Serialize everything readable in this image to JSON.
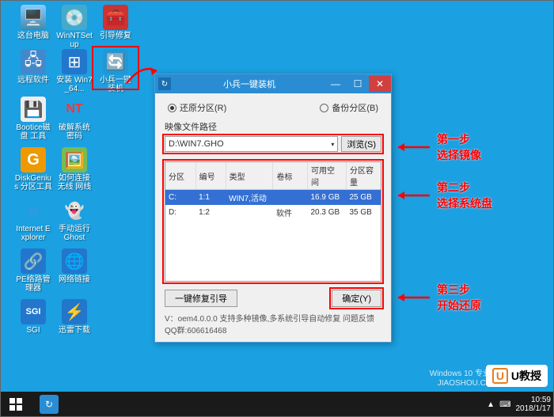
{
  "desktop_icons": {
    "r0c0": "这台电脑",
    "r0c1": "WinNTSetup",
    "r0c2": "引导修复",
    "r1c0": "远程软件",
    "r1c1": "安装\nWin7_64...",
    "r1c2": "小兵一键装机",
    "r2c0": "Bootice磁盘\n工具",
    "r2c1": "破解系统密码",
    "r3c0": "DiskGenius\n分区工具",
    "r3c1": "如何连接无线\n网线",
    "r4c0": "Internet\nExplorer",
    "r4c1": "手动运行\nGhost",
    "r5c0": "PE络路管理器",
    "r5c1": "网络链接",
    "r6c0": "SGI",
    "r6c1": "迅雷下载"
  },
  "dialog": {
    "title": "小兵一键装机",
    "restore_label": "还原分区(R)",
    "backup_label": "备份分区(B)",
    "image_path_label": "映像文件路径",
    "image_path_value": "D:\\WIN7.GHO",
    "browse_btn": "浏览(S)",
    "table": {
      "headers": [
        "分区",
        "编号",
        "类型",
        "卷标",
        "可用空间",
        "分区容量"
      ],
      "rows": [
        {
          "p": "C:",
          "id": "1:1",
          "type": "WIN7,活动",
          "label": "",
          "free": "16.9 GB",
          "size": "25 GB",
          "sel": true
        },
        {
          "p": "D:",
          "id": "1:2",
          "type": "",
          "label": "软件",
          "free": "20.3 GB",
          "size": "35 GB",
          "sel": false
        }
      ]
    },
    "repair_btn": "一键修复引导",
    "ok_btn": "确定(Y)",
    "status": "V：oem4.0.0.0        支持多种镜像,多系统引导自动修复 问题反馈QQ群:606616468"
  },
  "annotations": {
    "step1_title": "第一步",
    "step1_sub": "选择镜像",
    "step2_title": "第二步",
    "step2_sub": "选择系统盘",
    "step3_title": "第三步",
    "step3_sub": "开始还原"
  },
  "taskbar": {
    "time": "10:59",
    "date": "2018/1/17"
  },
  "watermark": {
    "l1": "Windows 10 专业版",
    "l2": "JIAOSHOU.COM"
  },
  "logo_text": "U教授"
}
